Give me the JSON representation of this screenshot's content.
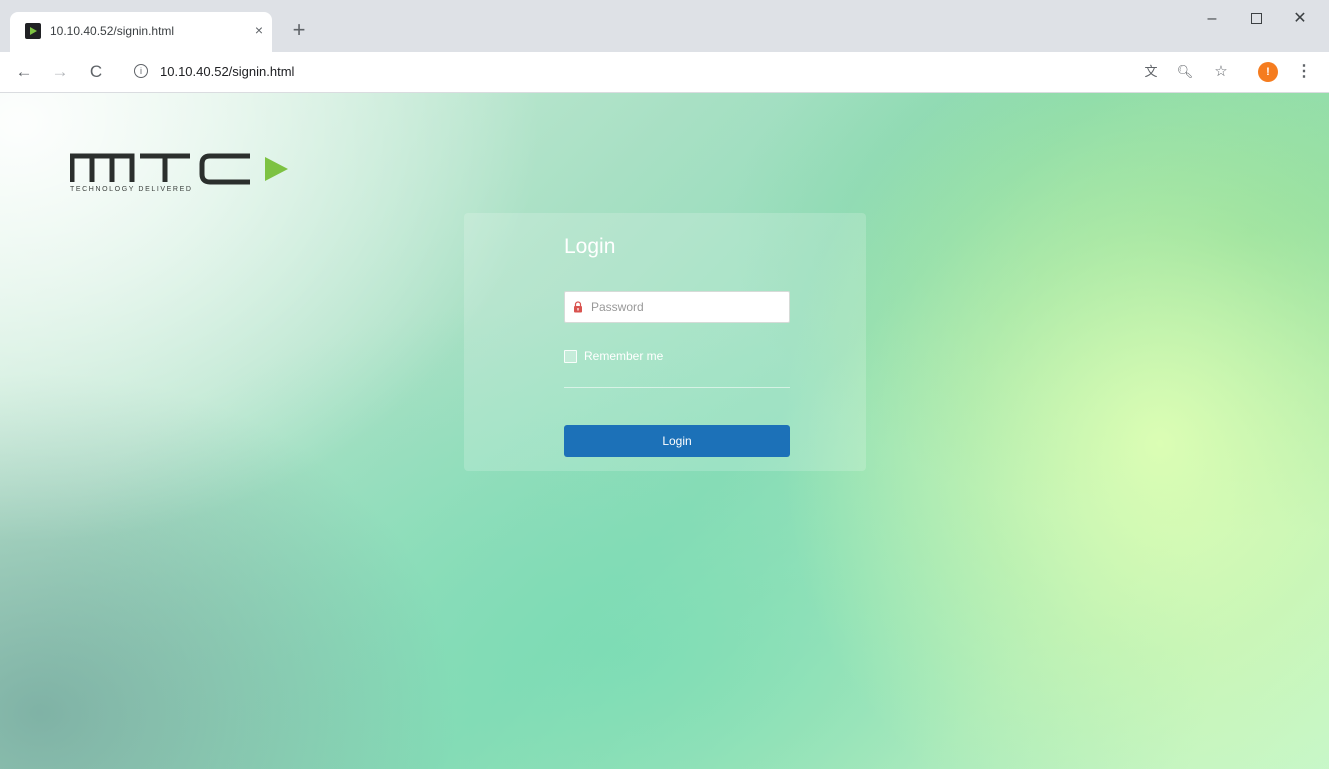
{
  "browser": {
    "tab": {
      "title": "10.10.40.52/signin.html",
      "close_glyph": "×"
    },
    "new_tab_glyph": "+",
    "window_controls": {
      "minimize_glyph": "–",
      "close_glyph": "✕"
    },
    "toolbar": {
      "back_glyph": "←",
      "forward_glyph": "→",
      "reload_glyph": "C",
      "info_glyph": "i",
      "url": "10.10.40.52/signin.html",
      "translate_glyph": "文",
      "zoom_glyph": "🔍︎",
      "star_glyph": "☆",
      "profile_initial": "!",
      "menu_glyph": "⋮"
    }
  },
  "page": {
    "logo": {
      "brand": "MTC",
      "tagline": "TECHNOLOGY DELIVERED",
      "arrow_color": "#7dc242"
    },
    "login": {
      "heading": "Login",
      "password_placeholder": "Password",
      "remember_label": "Remember me",
      "submit_label": "Login"
    }
  },
  "colors": {
    "button": "#1c71b8",
    "lock": "#d9534f"
  }
}
